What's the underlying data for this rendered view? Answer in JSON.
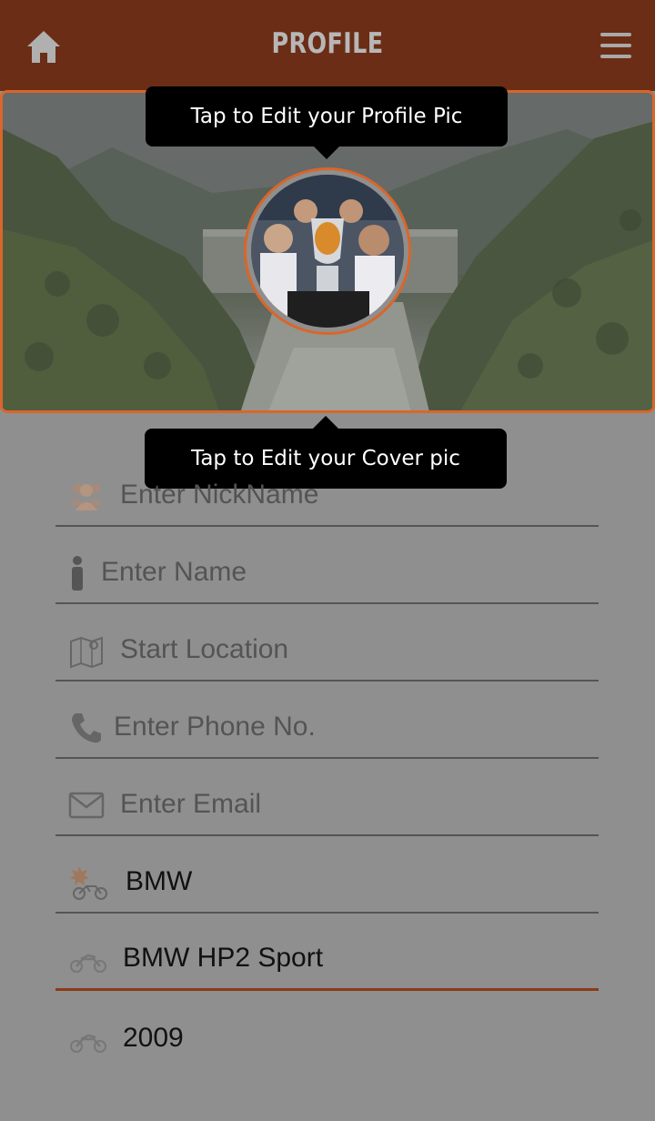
{
  "header": {
    "title": "PROFILE"
  },
  "tooltips": {
    "profile_pic": "Tap to Edit your Profile Pic",
    "cover_pic": "Tap to Edit your Cover pic"
  },
  "form": {
    "nickname": {
      "placeholder": "Enter NickName",
      "icon": "group-icon"
    },
    "name": {
      "placeholder": "Enter Name",
      "icon": "person-icon"
    },
    "location": {
      "placeholder": "Start Location",
      "icon": "map-icon"
    },
    "phone": {
      "placeholder": "Enter Phone No.",
      "icon": "phone-icon"
    },
    "email": {
      "placeholder": "Enter Email",
      "icon": "envelope-icon"
    },
    "brand": {
      "value": "BMW",
      "icon": "motorcycle-brand-icon"
    },
    "model": {
      "value": "BMW HP2 Sport",
      "icon": "motorcycle-icon"
    },
    "year": {
      "value": "2009",
      "icon": "motorcycle-icon"
    }
  },
  "colors": {
    "header": "#6b2d15",
    "accent": "#d9662a",
    "background": "#8f8f8f"
  }
}
